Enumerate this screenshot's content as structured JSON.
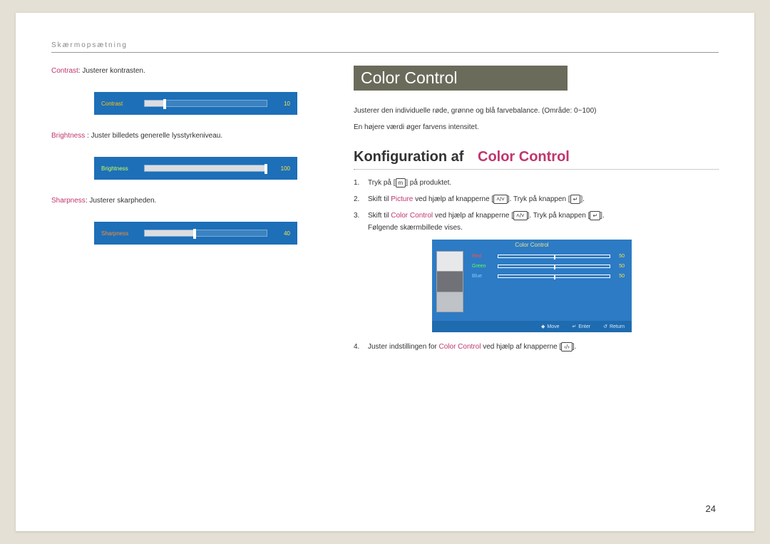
{
  "header": "Skærmopsætning",
  "left": {
    "contrast": {
      "term": "Contrast",
      "text": ": Justerer kontrasten.",
      "label": "Contrast",
      "value": "10",
      "fillPct": 15
    },
    "brightness": {
      "term": "Brightness",
      "text": " : Juster billedets generelle lysstyrkeniveau.",
      "label": "Brightness",
      "value": "100",
      "fillPct": 100
    },
    "sharpness": {
      "term": "Sharpness",
      "text": ": Justerer skarpheden.",
      "label": "Sharpness",
      "value": "40",
      "fillPct": 40
    }
  },
  "right": {
    "title": "Color Control",
    "para1": "Justerer den individuelle røde, grønne og blå farvebalance. (Område: 0~100)",
    "para2": "En højere værdi øger farvens intensitet.",
    "subheading_prefix": "Konfiguration af",
    "subheading_accent": "Color Control",
    "steps": {
      "s1": {
        "num": "1.",
        "before": "Tryk på [",
        "icon": "m",
        "after": "] på produktet."
      },
      "s2": {
        "num": "2.",
        "t1": "Skift til ",
        "picture": "Picture",
        "t2": " ved hjælp af knapperne [",
        "iconA": "˄/˅",
        "t3": "]. Tryk på knappen [",
        "iconB": "↵",
        "t4": "]."
      },
      "s3": {
        "num": "3.",
        "t1": "Skift til ",
        "cc": "Color Control",
        "t2": " ved hjælp af knapperne [",
        "iconA": "˄/˅",
        "t3": "]. Tryk på knappen [",
        "iconB": "↵",
        "t4": "].",
        "line2": "Følgende skærmbillede vises."
      },
      "s4": {
        "num": "4.",
        "t1": "Juster indstillingen for ",
        "cc": "Color Control",
        "t2": " ved hjælp af knapperne [",
        "icon": "‹/›",
        "t3": "]."
      }
    },
    "cc_preview": {
      "title": "Color Control",
      "red": {
        "name": "Red",
        "value": "50"
      },
      "green": {
        "name": "Green",
        "value": "50"
      },
      "blue": {
        "name": "Blue",
        "value": "50"
      },
      "footer": {
        "move": "Move",
        "enter": "Enter",
        "ret": "Return"
      }
    }
  },
  "page_number": "24"
}
